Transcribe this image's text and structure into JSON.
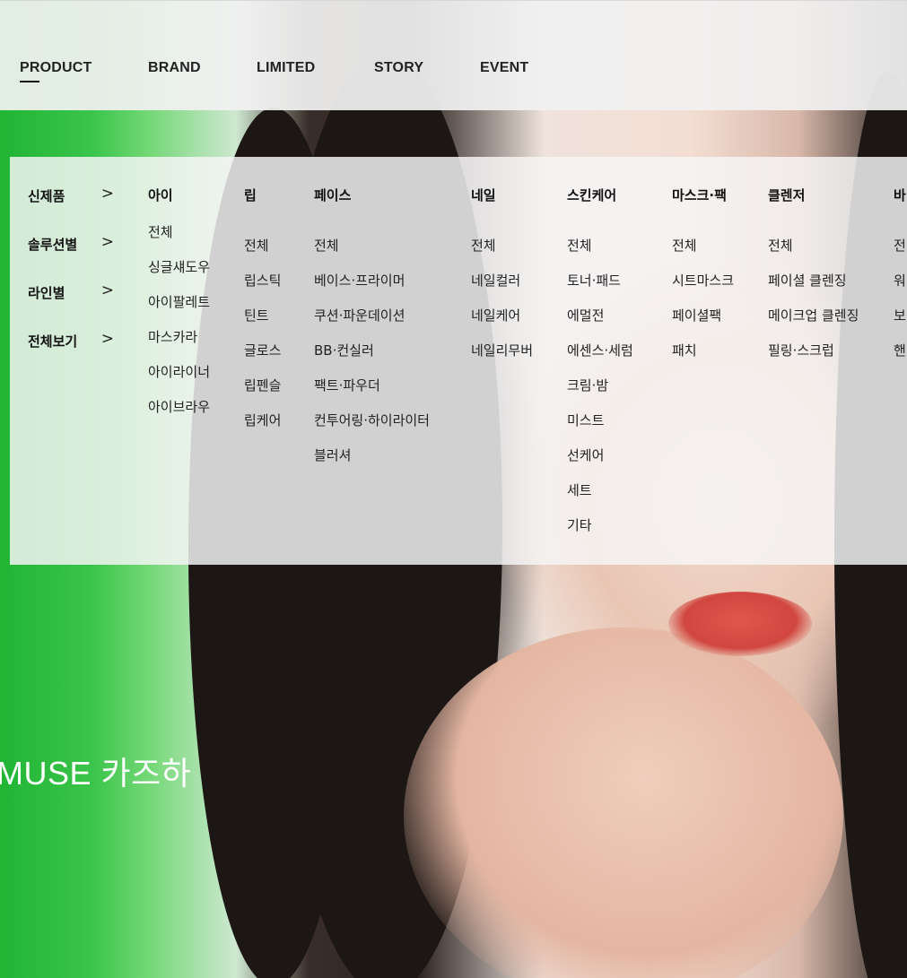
{
  "hero": {
    "caption": "MUSE 카즈하"
  },
  "topnav": {
    "items": [
      {
        "label": "PRODUCT",
        "active": true
      },
      {
        "label": "BRAND"
      },
      {
        "label": "LIMITED"
      },
      {
        "label": "STORY"
      },
      {
        "label": "EVENT"
      }
    ]
  },
  "megamenu": {
    "side": [
      {
        "label": "신제품",
        "icon": "chevron-right-icon"
      },
      {
        "label": "솔루션별",
        "icon": "chevron-right-icon"
      },
      {
        "label": "라인별",
        "icon": "chevron-right-icon"
      },
      {
        "label": "전체보기",
        "icon": "chevron-right-icon"
      }
    ],
    "columns": [
      {
        "title": "아이",
        "links": [
          "전체",
          "싱글섀도우",
          "아이팔레트",
          "마스카라",
          "아이라이너",
          "아이브라우"
        ]
      },
      {
        "title": "립",
        "links": [
          "전체",
          "립스틱",
          "틴트",
          "글로스",
          "립펜슬",
          "립케어"
        ]
      },
      {
        "title": "페이스",
        "links": [
          "전체",
          "베이스·프라이머",
          "쿠션·파운데이션",
          "BB·컨실러",
          "팩트·파우더",
          "컨투어링·하이라이터",
          "블러셔"
        ]
      },
      {
        "title": "네일",
        "links": [
          "전체",
          "네일컬러",
          "네일케어",
          "네일리무버"
        ]
      },
      {
        "title": "스킨케어",
        "links": [
          "전체",
          "토너·패드",
          "에멀전",
          "에센스·세럼",
          "크림·밤",
          "미스트",
          "선케어",
          "세트",
          "기타"
        ]
      },
      {
        "title": "마스크·팩",
        "links": [
          "전체",
          "시트마스크",
          "페이셜팩",
          "패치"
        ]
      },
      {
        "title": "클렌저",
        "links": [
          "전체",
          "페이셜 클렌징",
          "메이크업 클렌징",
          "필링·스크럽"
        ]
      },
      {
        "title": "바",
        "links": [
          "전",
          "워",
          "보",
          "핸"
        ]
      }
    ]
  }
}
